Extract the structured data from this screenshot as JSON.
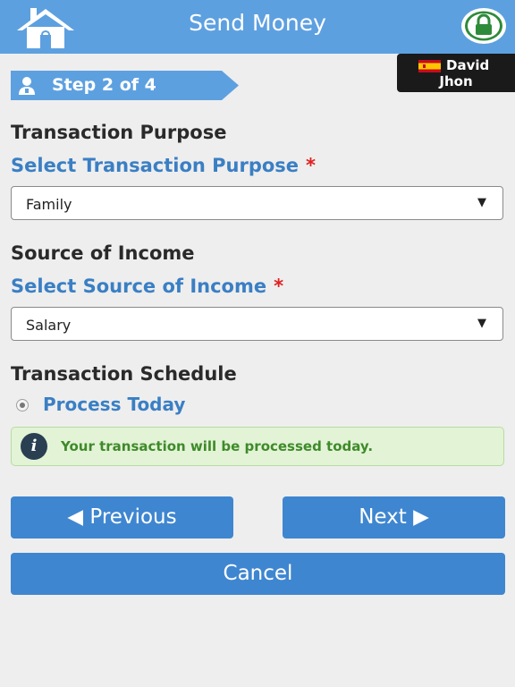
{
  "header": {
    "title": "Send Money",
    "home_icon": "home-icon",
    "lock_icon": "lock-icon",
    "color": "#5da0e0"
  },
  "user": {
    "first_name": "David",
    "last_name": "Jhon",
    "flag_icon": "spain-flag-icon"
  },
  "step": {
    "label": "Step 2 of 4",
    "icon": "user-icon"
  },
  "purpose": {
    "title": "Transaction Purpose",
    "label": "Select Transaction Purpose",
    "required": "*",
    "value": "Family"
  },
  "income": {
    "title": "Source of Income",
    "label": "Select Source of Income",
    "required": "*",
    "value": "Salary"
  },
  "schedule": {
    "title": "Transaction Schedule",
    "option": "Process Today",
    "info_icon": "info-icon",
    "info": "Your transaction will be processed today."
  },
  "buttons": {
    "previous": "◀ Previous",
    "next": "Next ▶",
    "cancel": "Cancel",
    "color": "#3f86d0"
  },
  "colors": {
    "accent_text": "#3a7fc4",
    "required": "#e02020",
    "info_bg": "#e2f3d6"
  }
}
